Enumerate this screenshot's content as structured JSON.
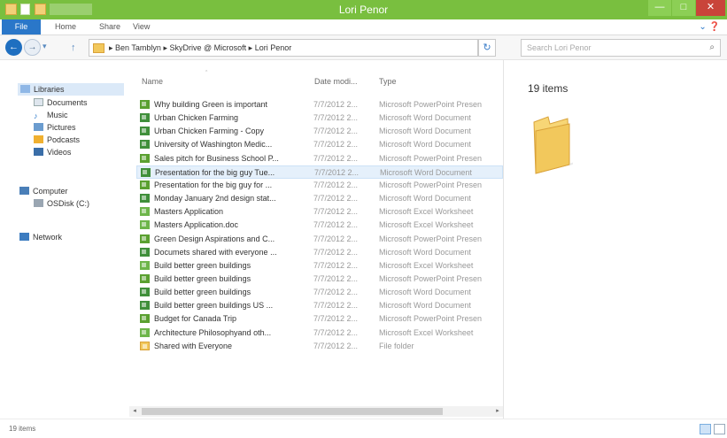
{
  "window": {
    "title": "Lori Penor"
  },
  "ribbon": {
    "tabs": [
      {
        "label": "File"
      },
      {
        "label": "Home"
      },
      {
        "label": "Share"
      },
      {
        "label": "View"
      }
    ]
  },
  "address": {
    "crumbs": [
      "Ben Tamblyn",
      "SkyDrive @ Microsoft",
      "Lori Penor"
    ],
    "separator": "▸"
  },
  "search": {
    "placeholder": "Search Lori Penor"
  },
  "navpane": {
    "libraries": "Libraries",
    "library_items": [
      "Documents",
      "Music",
      "Pictures",
      "Podcasts",
      "Videos"
    ],
    "computer": "Computer",
    "drive": "OSDisk (C:)",
    "network": "Network"
  },
  "columns": {
    "name": "Name",
    "date": "Date modi...",
    "type": "Type"
  },
  "files": [
    {
      "name": "Why building Green is important",
      "date": "7/7/2012 2...",
      "type": "Microsoft PowerPoint Presen",
      "icon": "powerpoint-icon"
    },
    {
      "name": "Urban Chicken Farming",
      "date": "7/7/2012 2...",
      "type": "Microsoft Word Document",
      "icon": "word-icon"
    },
    {
      "name": "Urban Chicken Farming - Copy",
      "date": "7/7/2012 2...",
      "type": "Microsoft Word Document",
      "icon": "word-icon"
    },
    {
      "name": "University of Washington Medic...",
      "date": "7/7/2012 2...",
      "type": "Microsoft Word Document",
      "icon": "word-icon"
    },
    {
      "name": "Sales pitch for Business School P...",
      "date": "7/7/2012 2...",
      "type": "Microsoft PowerPoint Presen",
      "icon": "powerpoint-icon"
    },
    {
      "name": "Presentation for the big guy Tue...",
      "date": "7/7/2012 2...",
      "type": "Microsoft Word Document",
      "icon": "word-icon"
    },
    {
      "name": "Presentation for the big guy for ...",
      "date": "7/7/2012 2...",
      "type": "Microsoft PowerPoint Presen",
      "icon": "powerpoint-icon"
    },
    {
      "name": "Monday January 2nd design stat...",
      "date": "7/7/2012 2...",
      "type": "Microsoft Word Document",
      "icon": "word-icon"
    },
    {
      "name": "Masters Application",
      "date": "7/7/2012 2...",
      "type": "Microsoft Excel Worksheet",
      "icon": "excel-icon"
    },
    {
      "name": "Masters Application.doc",
      "date": "7/7/2012 2...",
      "type": "Microsoft Excel Worksheet",
      "icon": "excel-icon"
    },
    {
      "name": "Green Design Aspirations and C...",
      "date": "7/7/2012 2...",
      "type": "Microsoft PowerPoint Presen",
      "icon": "powerpoint-icon"
    },
    {
      "name": "Documets shared with everyone ...",
      "date": "7/7/2012 2...",
      "type": "Microsoft Word Document",
      "icon": "word-icon"
    },
    {
      "name": "Build better green buildings",
      "date": "7/7/2012 2...",
      "type": "Microsoft Excel Worksheet",
      "icon": "excel-icon"
    },
    {
      "name": "Build better green buildings",
      "date": "7/7/2012 2...",
      "type": "Microsoft PowerPoint Presen",
      "icon": "powerpoint-icon"
    },
    {
      "name": "Build better green buildings",
      "date": "7/7/2012 2...",
      "type": "Microsoft Word Document",
      "icon": "word-icon"
    },
    {
      "name": "Build better green buildings US ...",
      "date": "7/7/2012 2...",
      "type": "Microsoft Word Document",
      "icon": "word-icon"
    },
    {
      "name": "Budget for Canada Trip",
      "date": "7/7/2012 2...",
      "type": "Microsoft PowerPoint Presen",
      "icon": "powerpoint-icon"
    },
    {
      "name": "Architecture Philosophyand oth...",
      "date": "7/7/2012 2...",
      "type": "Microsoft Excel Worksheet",
      "icon": "excel-icon"
    },
    {
      "name": "Shared with Everyone",
      "date": "7/7/2012 2...",
      "type": "File folder",
      "icon": "folder-icon"
    }
  ],
  "selected_index": 5,
  "preview": {
    "count": "19 items"
  },
  "status": {
    "text": "19 items"
  }
}
